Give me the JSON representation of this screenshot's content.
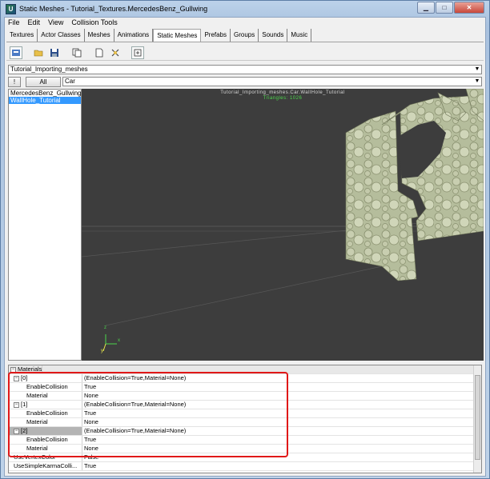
{
  "window": {
    "title": "Static Meshes - Tutorial_Textures.MercedesBenz_Gullwing",
    "app_icon_glyph": "U"
  },
  "menu": [
    {
      "label": "File"
    },
    {
      "label": "Edit"
    },
    {
      "label": "View"
    },
    {
      "label": "Collision Tools"
    }
  ],
  "tabs": [
    "Textures",
    "Actor Classes",
    "Meshes",
    "Animations",
    "Static Meshes",
    "Prefabs",
    "Groups",
    "Sounds",
    "Music"
  ],
  "active_tab": "Static Meshes",
  "toolbar": {
    "icons": [
      "import-icon",
      "open-icon",
      "save-icon",
      "copy-icon",
      "new-icon",
      "properties-icon",
      "reload-icon"
    ]
  },
  "package_combo": {
    "value": "Tutorial_Importing_meshes"
  },
  "filter": {
    "bang_label": "!",
    "all_label": "All",
    "value": "Car"
  },
  "mesh_list": {
    "items": [
      "MercedesBenz_Gullwing",
      "WallHole_Tutorial"
    ],
    "selected": "WallHole_Tutorial"
  },
  "viewport": {
    "caption": "Tutorial_Importing_meshes.Car.WallHole_Tutorial",
    "triangles": "Triangles: 1026",
    "axis_z": "z",
    "axis_x": "x",
    "axis_y": "y",
    "bg_color": "#3d3d3d"
  },
  "properties": {
    "rows": [
      {
        "name": "Materials",
        "value": "",
        "kind": "category"
      },
      {
        "name": "[0]",
        "value": "(EnableCollision=True,Material=None)",
        "kind": "group"
      },
      {
        "name": "EnableCollision",
        "value": "True",
        "kind": "child"
      },
      {
        "name": "Material",
        "value": "None",
        "kind": "child"
      },
      {
        "name": "[1]",
        "value": "(EnableCollision=True,Material=None)",
        "kind": "group"
      },
      {
        "name": "EnableCollision",
        "value": "True",
        "kind": "child"
      },
      {
        "name": "Material",
        "value": "None",
        "kind": "child"
      },
      {
        "name": "[2]",
        "value": "(EnableCollision=True,Material=None)",
        "kind": "group",
        "selected": true
      },
      {
        "name": "EnableCollision",
        "value": "True",
        "kind": "child"
      },
      {
        "name": "Material",
        "value": "None",
        "kind": "child"
      },
      {
        "name": "UseVertexColor",
        "value": "False",
        "kind": "plain"
      },
      {
        "name": "UseSimpleKarmaColli...",
        "value": "True",
        "kind": "plain"
      }
    ]
  },
  "colors": {
    "highlight": "#e01818",
    "selection": "#3399ff",
    "axis_green": "#4cd64c"
  }
}
